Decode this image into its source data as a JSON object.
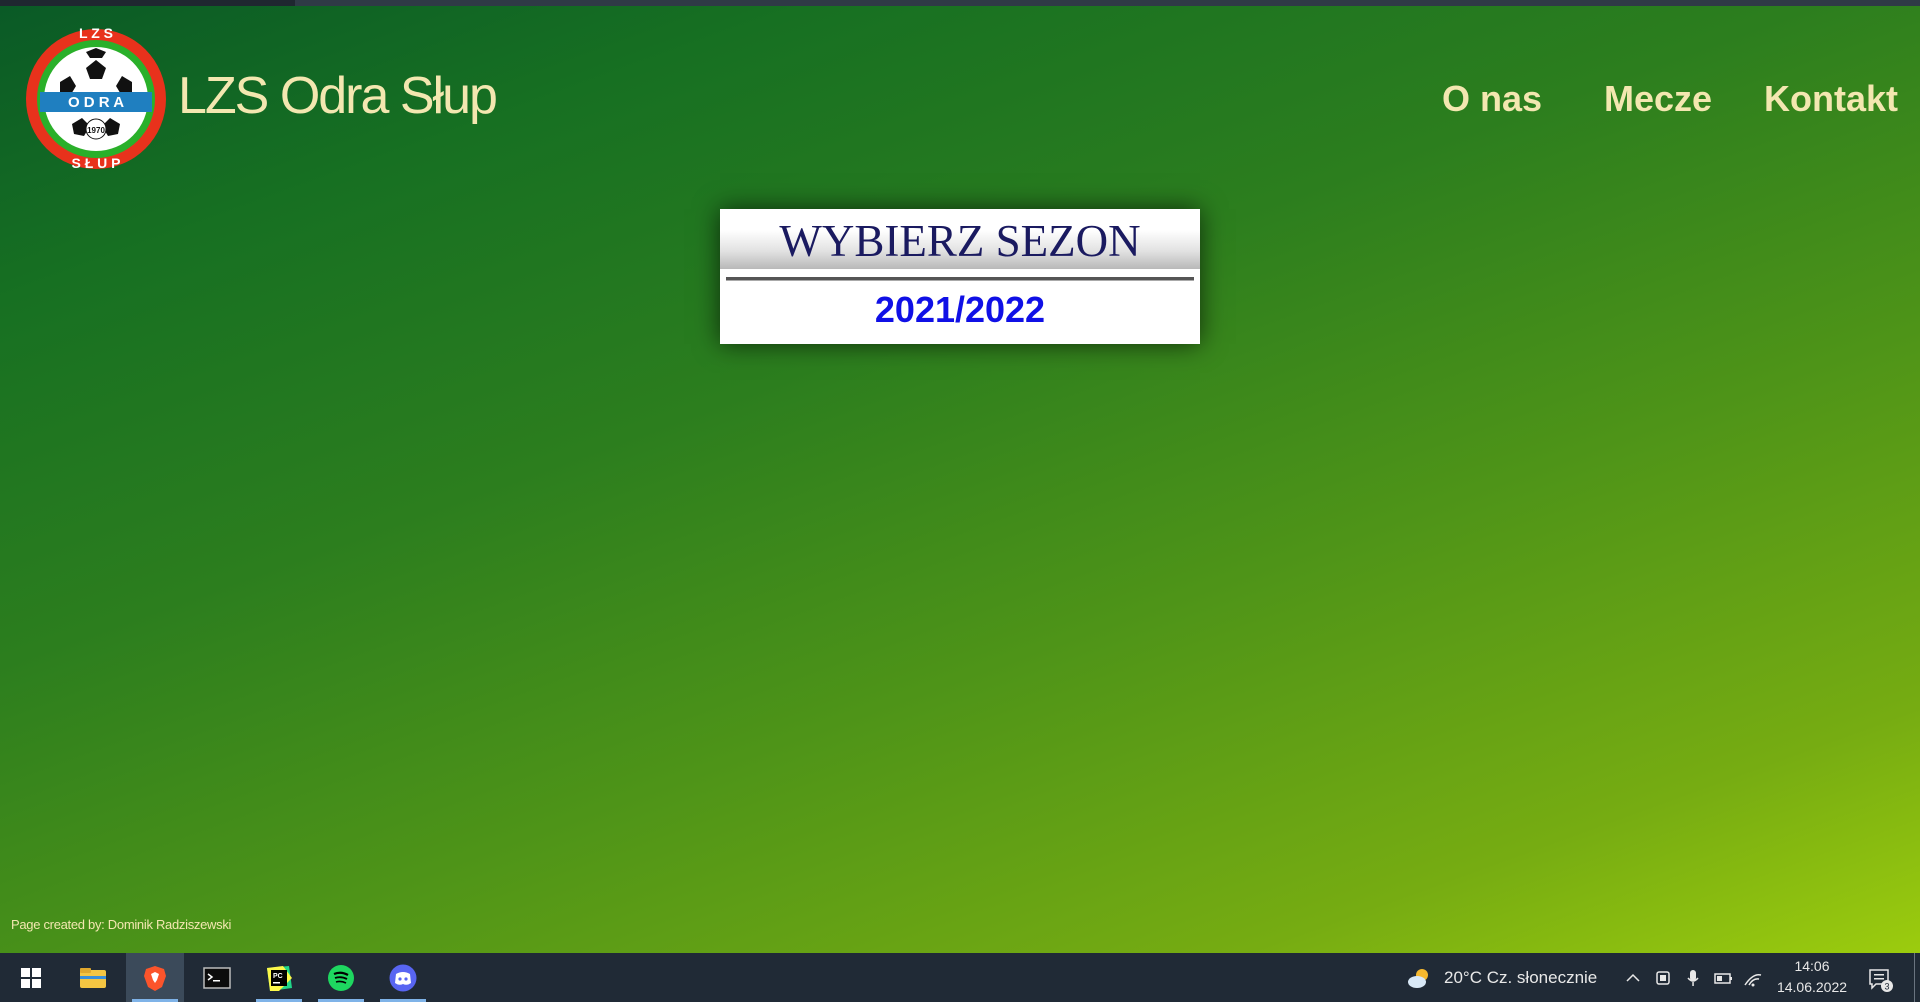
{
  "header": {
    "site_title": "LZS Odra Słup",
    "logo": {
      "top_text": "L Z S",
      "band_text": "O D R A",
      "year": "1970",
      "bottom_text": "S Ł U P"
    },
    "nav": [
      "O nas",
      "Mecze",
      "Kontakt"
    ]
  },
  "season_card": {
    "heading": "WYBIERZ SEZON",
    "season": "2021/2022"
  },
  "footer": {
    "credit": "Page created by: Dominik Radziszewski"
  },
  "taskbar": {
    "apps": [
      "start-icon",
      "file-explorer-icon",
      "brave-browser-icon",
      "terminal-icon",
      "pycharm-icon",
      "spotify-icon",
      "discord-icon"
    ],
    "weather": "20°C  Cz. słonecznie",
    "time": "14:06",
    "date": "14.06.2022",
    "notification_count": "3"
  },
  "colors": {
    "nav_text": "#f3e7b0",
    "season_link": "#1010e6",
    "card_heading": "#1a1a60"
  }
}
